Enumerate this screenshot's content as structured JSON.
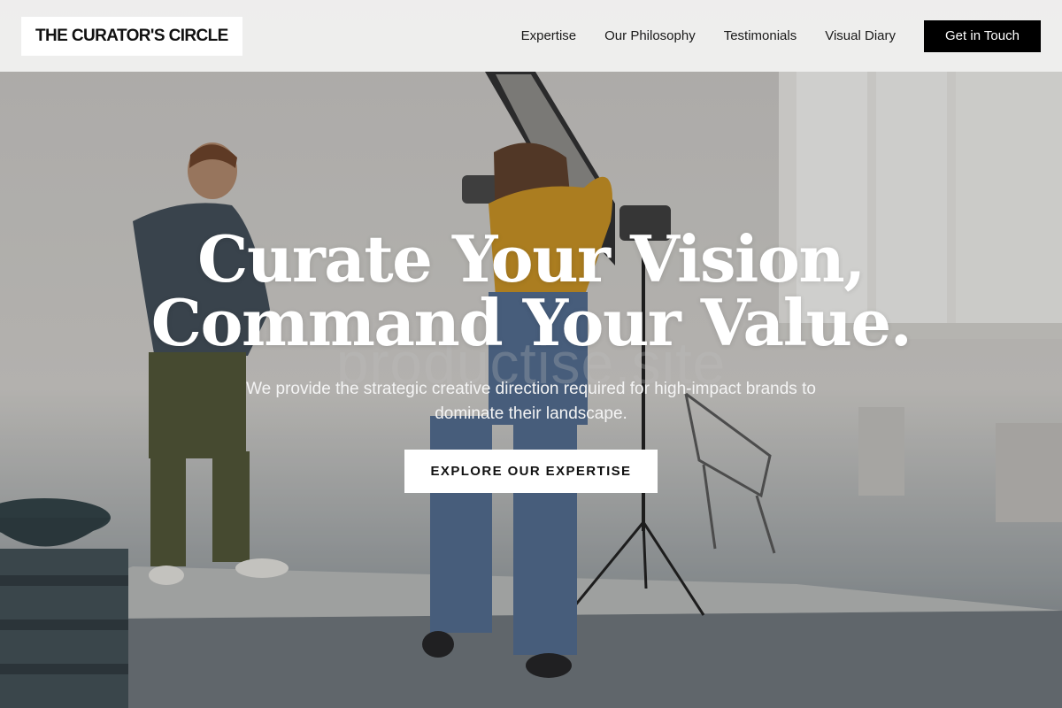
{
  "brand": {
    "logo_text": "THE CURATOR'S CIRCLE"
  },
  "nav": {
    "links": [
      "Expertise",
      "Our Philosophy",
      "Testimonials",
      "Visual Diary"
    ],
    "cta_label": "Get in Touch"
  },
  "hero": {
    "title_line1": "Curate Your Vision,",
    "title_line2": "Command Your Value.",
    "subtitle": "We provide the strategic creative direction required for high-impact brands to dominate their landscape.",
    "cta_label": "EXPLORE OUR EXPERTISE",
    "watermark": "productise.site",
    "background_image": "photo-studio-shoot-image"
  },
  "colors": {
    "nav_bg": "#f0f0ef",
    "cta_bg": "#000000",
    "hero_text": "#ffffff",
    "hero_button_bg": "#ffffff"
  }
}
